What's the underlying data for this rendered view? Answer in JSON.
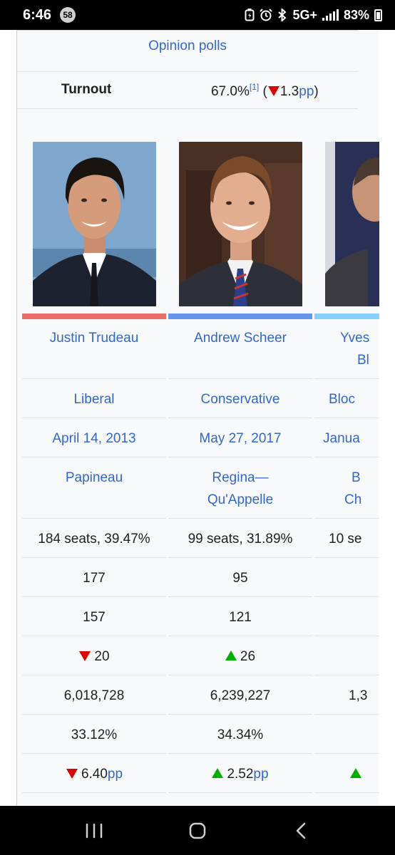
{
  "status_bar": {
    "time": "6:46",
    "notification_count": "58",
    "network": "5G+",
    "battery": "83%"
  },
  "infobox": {
    "opinion_polls_label": "Opinion polls",
    "turnout": {
      "label": "Turnout",
      "value": "67.0%",
      "ref": "[1]",
      "change_prefix": "(",
      "change_value": "1.3",
      "change_unit": "pp",
      "change_suffix": ")"
    },
    "candidates": [
      {
        "leader_line1": "Justin Trudeau",
        "leader_line2": "",
        "party": "Liberal",
        "leader_since": "April 14, 2013",
        "seat_line1": "Papineau",
        "seat_line2": "",
        "last_election": "184 seats, 39.47%",
        "seats_before": "177",
        "seats_won": "157",
        "seat_change": "20",
        "seat_change_dir": "down",
        "popular_vote": "6,018,728",
        "percentage": "33.12%",
        "swing": "6.40",
        "swing_unit": "pp",
        "swing_dir": "down",
        "color": "#ea6d6a"
      },
      {
        "leader_line1": "Andrew Scheer",
        "leader_line2": "",
        "party": "Conservative",
        "leader_since": "May 27, 2017",
        "seat_line1": "Regina—",
        "seat_line2": "Qu'Appelle",
        "last_election": "99 seats, 31.89%",
        "seats_before": "95",
        "seats_won": "121",
        "seat_change": "26",
        "seat_change_dir": "up",
        "popular_vote": "6,239,227",
        "percentage": "34.34%",
        "swing": "2.52",
        "swing_unit": "pp",
        "swing_dir": "up",
        "color": "#6495ed"
      },
      {
        "leader_line1": "Yves",
        "leader_line2": "Bl",
        "party": "Bloc",
        "leader_since": "Janua",
        "seat_line1": "B",
        "seat_line2": "Ch",
        "last_election": "10 se",
        "seats_before": "",
        "seats_won": "",
        "seat_change": "",
        "popular_vote": "1,3",
        "percentage": "",
        "swing": "",
        "swing_dir": "up",
        "color": "#87cefa"
      }
    ]
  },
  "nav_bar": {
    "recents": "recents-icon",
    "home": "home-icon",
    "back": "back-icon"
  }
}
